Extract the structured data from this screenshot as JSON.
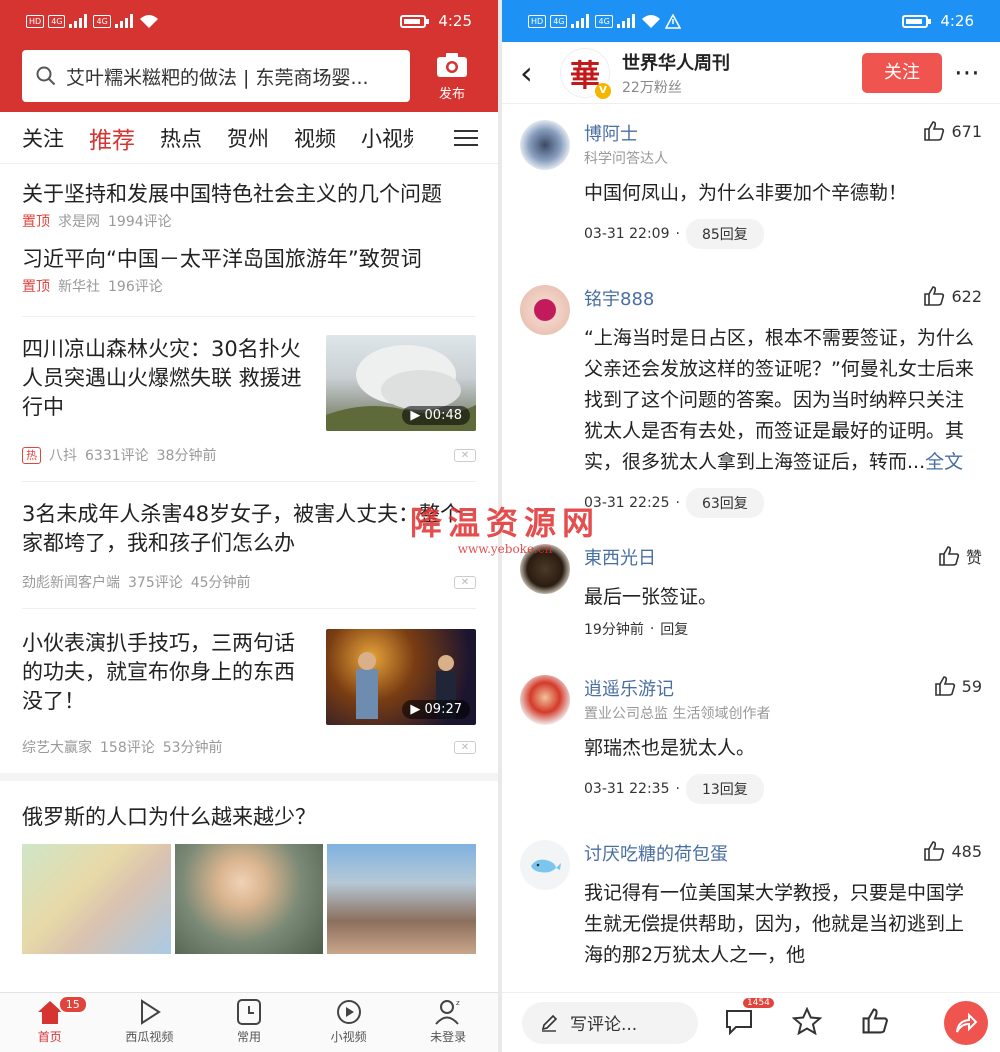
{
  "left": {
    "status": {
      "time": "4:25",
      "sim1": "4G",
      "sim2": "4G",
      "hd": "HD"
    },
    "search": {
      "text": "艾叶糯米糍粑的做法 | 东莞商场婴...",
      "publish_label": "发布"
    },
    "tabs": [
      "关注",
      "推荐",
      "热点",
      "贺州",
      "视频",
      "小视频"
    ],
    "active_tab": "推荐",
    "feed": [
      {
        "title": "关于坚持和发展中国特色社会主义的几个问题",
        "pin": "置顶",
        "source": "求是网",
        "comments": "1994评论"
      },
      {
        "title": "习近平向“中国－太平洋岛国旅游年”致贺词",
        "pin": "置顶",
        "source": "新华社",
        "comments": "196评论"
      },
      {
        "title": "四川凉山森林火灾：30名扑火人员突遇山火爆燃失联 救援进行中",
        "hot": "热",
        "source": "八抖",
        "comments": "6331评论",
        "time": "38分钟前",
        "duration": "00:48"
      },
      {
        "title": "3名未成年人杀害48岁女子，被害人丈夫：整个家都垮了，我和孩子们怎么办",
        "source": "劲彪新闻客户端",
        "comments": "375评论",
        "time": "45分钟前"
      },
      {
        "title": "小伙表演扒手技巧，三两句话的功夫，就宣布你身上的东西没了！",
        "source": "综艺大赢家",
        "comments": "158评论",
        "time": "53分钟前",
        "duration": "09:27"
      },
      {
        "title": "俄罗斯的人口为什么越来越少？"
      }
    ],
    "bottom_nav": [
      {
        "label": "首页",
        "icon": "home-icon",
        "badge": "15"
      },
      {
        "label": "西瓜视频",
        "icon": "play-icon"
      },
      {
        "label": "常用",
        "icon": "clock-icon"
      },
      {
        "label": "小视频",
        "icon": "short-video-icon"
      },
      {
        "label": "未登录",
        "icon": "user-icon"
      }
    ]
  },
  "right": {
    "status": {
      "time": "4:26",
      "sim1": "4G",
      "sim2": "4G",
      "hd": "HD"
    },
    "author": {
      "logo_char": "華",
      "name": "世界华人周刊",
      "fans": "22万粉丝",
      "follow_label": "关注"
    },
    "comments": [
      {
        "name": "博阿士",
        "sub": "科学问答达人",
        "likes": "671",
        "text": "中国何凤山，为什么非要加个辛德勒！",
        "time": "03-31 22:09",
        "replies": "85回复"
      },
      {
        "name": "铭宇888",
        "likes": "622",
        "text": "“上海当时是日占区，根本不需要签证，为什么父亲还会发放这样的签证呢？”何曼礼女士后来找到了这个问题的答案。因为当时纳粹只关注犹太人是否有去处，而签证是最好的证明。其实，很多犹太人拿到上海签证后，转而...",
        "more": "全文",
        "time": "03-31 22:25",
        "replies": "63回复"
      },
      {
        "name": "東西光日",
        "likes": "赞",
        "text": "最后一张签证。",
        "time": "19分钟前",
        "replies": "回复"
      },
      {
        "name": "逍遥乐游记",
        "sub": "置业公司总监 生活领域创作者",
        "likes": "59",
        "text": "郭瑞杰也是犹太人。",
        "time": "03-31 22:35",
        "replies": "13回复"
      },
      {
        "name": "讨厌吃糖的荷包蛋",
        "likes": "485",
        "text": "我记得有一位美国某大学教授，只要是中国学生就无偿提供帮助，因为，他就是当初逃到上海的那2万犹太人之一，他"
      }
    ],
    "comment_bar": {
      "placeholder": "写评论...",
      "comment_count": "1454"
    }
  },
  "watermark": {
    "title": "降温资源网",
    "url": "www.yeboke.cn"
  },
  "colors": {
    "left_header": "#d53431",
    "right_status": "#1d92f4",
    "accent": "#f0544f",
    "link": "#4a6fa3"
  }
}
